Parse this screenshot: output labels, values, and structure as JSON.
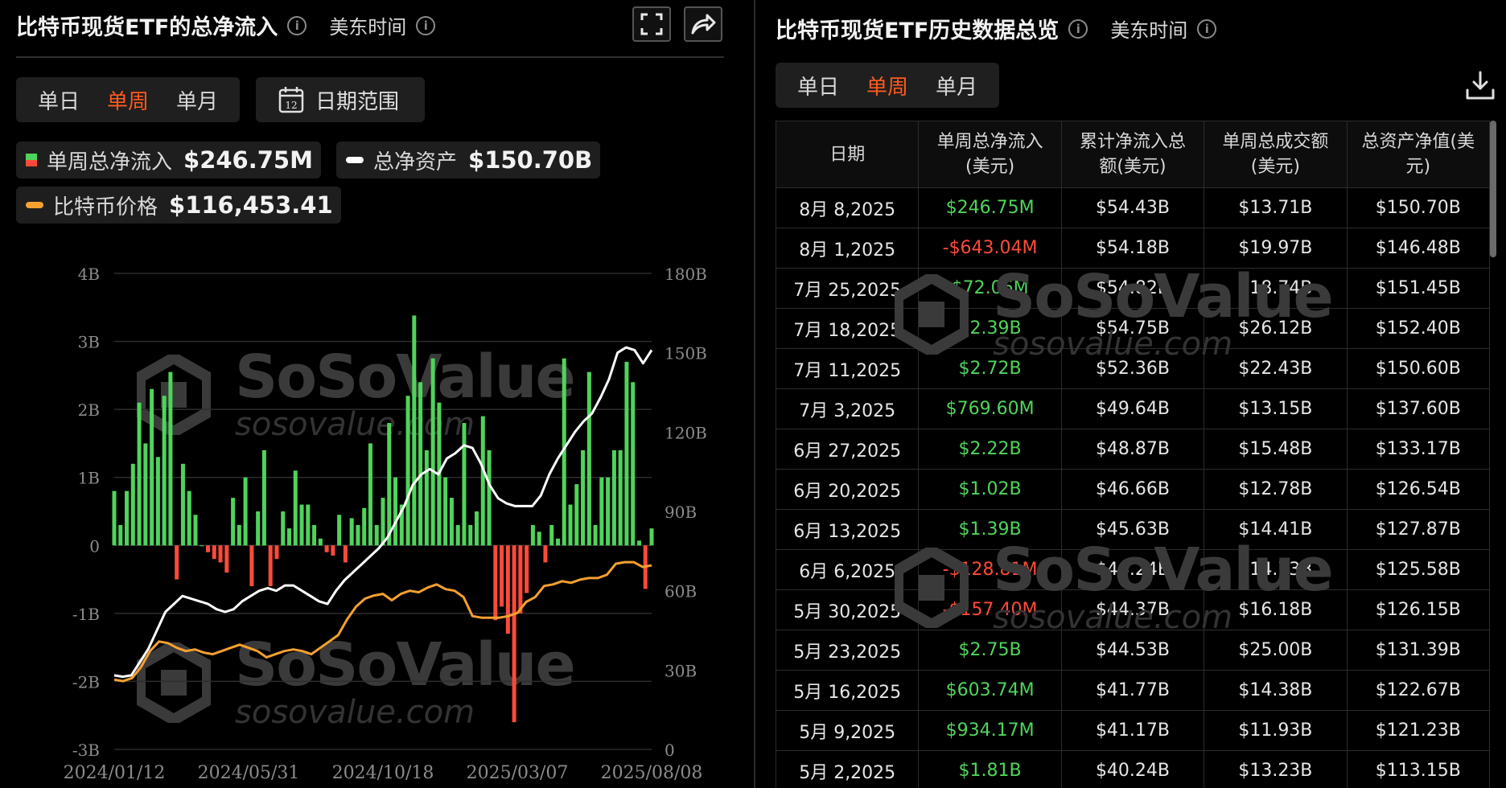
{
  "left": {
    "title": "比特币现货ETF的总净流入",
    "timezone": "美东时间",
    "period_tabs": [
      "单日",
      "单周",
      "单月"
    ],
    "active_period": "单周",
    "date_range_label": "日期范围",
    "calendar_day": "12",
    "legend": {
      "net_inflow": {
        "label": "单周总净流入",
        "value": "$246.75M"
      },
      "total_assets": {
        "label": "总净资产",
        "value": "$150.70B"
      },
      "btc_price": {
        "label": "比特币价格",
        "value": "$116,453.41"
      }
    }
  },
  "right": {
    "title": "比特币现货ETF历史数据总览",
    "timezone": "美东时间",
    "period_tabs": [
      "单日",
      "单周",
      "单月"
    ],
    "active_period": "单周",
    "columns": [
      [
        "日期"
      ],
      [
        "单周总净流入",
        "(美元)"
      ],
      [
        "累计净流入总",
        "额(美元)"
      ],
      [
        "单周总成交额",
        "(美元)"
      ],
      [
        "总资产净值(美",
        "元)"
      ]
    ],
    "rows": [
      [
        "8月 8,2025",
        "$246.75M",
        "$54.43B",
        "$13.71B",
        "$150.70B"
      ],
      [
        "8月 1,2025",
        "-$643.04M",
        "$54.18B",
        "$19.97B",
        "$146.48B"
      ],
      [
        "7月 25,2025",
        "$72.06M",
        "$54.82B",
        "$18.74B",
        "$151.45B"
      ],
      [
        "7月 18,2025",
        "$2.39B",
        "$54.75B",
        "$26.12B",
        "$152.40B"
      ],
      [
        "7月 11,2025",
        "$2.72B",
        "$52.36B",
        "$22.43B",
        "$150.60B"
      ],
      [
        "7月 3,2025",
        "$769.60M",
        "$49.64B",
        "$13.15B",
        "$137.60B"
      ],
      [
        "6月 27,2025",
        "$2.22B",
        "$48.87B",
        "$15.48B",
        "$133.17B"
      ],
      [
        "6月 20,2025",
        "$1.02B",
        "$46.66B",
        "$12.78B",
        "$126.54B"
      ],
      [
        "6月 13,2025",
        "$1.39B",
        "$45.63B",
        "$14.41B",
        "$127.87B"
      ],
      [
        "6月 6,2025",
        "-$128.81M",
        "$44.24B",
        "$14.73B",
        "$125.58B"
      ],
      [
        "5月 30,2025",
        "-$157.40M",
        "$44.37B",
        "$16.18B",
        "$126.15B"
      ],
      [
        "5月 23,2025",
        "$2.75B",
        "$44.53B",
        "$25.00B",
        "$131.39B"
      ],
      [
        "5月 16,2025",
        "$603.74M",
        "$41.77B",
        "$14.38B",
        "$122.67B"
      ],
      [
        "5月 9,2025",
        "$934.17M",
        "$41.17B",
        "$11.93B",
        "$121.23B"
      ],
      [
        "5月 2,2025",
        "$1.81B",
        "$40.24B",
        "$13.23B",
        "$113.15B"
      ]
    ]
  },
  "watermark": {
    "brand": "SoSoValue",
    "domain": "sosovalue.com"
  },
  "colors": {
    "positive": "#4fd45b",
    "negative": "#ff4a3a",
    "accent": "#ff5a1f",
    "assets_line": "#ffffff",
    "price_line": "#f5a030"
  },
  "chart_data": {
    "type": "bar",
    "title": "",
    "x_tick_labels": [
      "2024/01/12",
      "2024/05/31",
      "2024/10/18",
      "2025/03/07",
      "2025/08/08"
    ],
    "x_range": [
      "2024-01-12",
      "2025-08-08"
    ],
    "y_left_ticks": [
      "4B",
      "3B",
      "2B",
      "1B",
      "0",
      "-1B",
      "-2B",
      "-3B"
    ],
    "y_left_range": [
      -3,
      4
    ],
    "y_right_ticks": [
      "180B",
      "150B",
      "120B",
      "90B",
      "60B",
      "30B",
      "0"
    ],
    "y_right_range": [
      0,
      180
    ],
    "series": [
      {
        "type": "bar",
        "unit": "B USD",
        "values": [
          0.8,
          0.3,
          0.8,
          1.2,
          2.1,
          1.5,
          2.3,
          1.3,
          2.2,
          2.55,
          -0.5,
          1.2,
          0.8,
          0.45,
          0,
          -0.1,
          -0.2,
          -0.25,
          -0.4,
          0.7,
          0.3,
          1.0,
          -0.6,
          0.5,
          1.4,
          -0.6,
          -0.2,
          0.5,
          0.25,
          1.1,
          0.6,
          0.6,
          0.3,
          0.1,
          -0.1,
          -0.15,
          0.45,
          -0.25,
          0.4,
          0.3,
          0.55,
          1.5,
          0.3,
          0.7,
          1.8,
          1.0,
          0.6,
          2.2,
          3.38,
          2.4,
          1.4,
          2.75,
          2.1,
          1.0,
          0.7,
          0.3,
          1.8,
          0.3,
          0.5,
          1.9,
          1.4,
          -1.1,
          -0.9,
          -1.3,
          -2.6,
          -1.0,
          -0.7,
          0.3,
          0.2,
          -0.25,
          0.3,
          0.1,
          2.75,
          0.6,
          0.9,
          1.4,
          2.55,
          0.3,
          1.0,
          1.0,
          1.4,
          1.4,
          2.7,
          2.4,
          0.07,
          -0.64,
          0.25
        ]
      },
      {
        "type": "line",
        "name": "总净资产",
        "unit": "B USD",
        "values": [
          28,
          27.5,
          28,
          33,
          38,
          45,
          52,
          55,
          58,
          57,
          56,
          55,
          53,
          52,
          53,
          56,
          58,
          60,
          61,
          60,
          62,
          62,
          60,
          58,
          56,
          55,
          60,
          64,
          67,
          70,
          73,
          76,
          80,
          86,
          92,
          100,
          104,
          106,
          104,
          110,
          112,
          115,
          114,
          108,
          100,
          95,
          93,
          92,
          92,
          92,
          96,
          104,
          110,
          115,
          120,
          124,
          127,
          133,
          140,
          150,
          152,
          151,
          146,
          151
        ]
      },
      {
        "type": "line",
        "name": "比特币价格",
        "unit": "$K",
        "values": [
          44,
          43,
          45,
          52,
          62,
          68,
          67,
          64,
          62,
          63,
          61,
          60,
          62,
          64,
          66,
          64,
          62,
          58,
          60,
          62,
          63,
          62,
          60,
          64,
          68,
          72,
          82,
          90,
          95,
          97,
          98,
          94,
          98,
          100,
          99,
          102,
          104,
          101,
          100,
          96,
          84,
          83,
          83,
          83,
          84,
          86,
          93,
          96,
          103,
          104,
          106,
          105,
          107,
          108,
          108,
          110,
          117,
          118,
          118,
          115,
          116
        ]
      }
    ]
  }
}
